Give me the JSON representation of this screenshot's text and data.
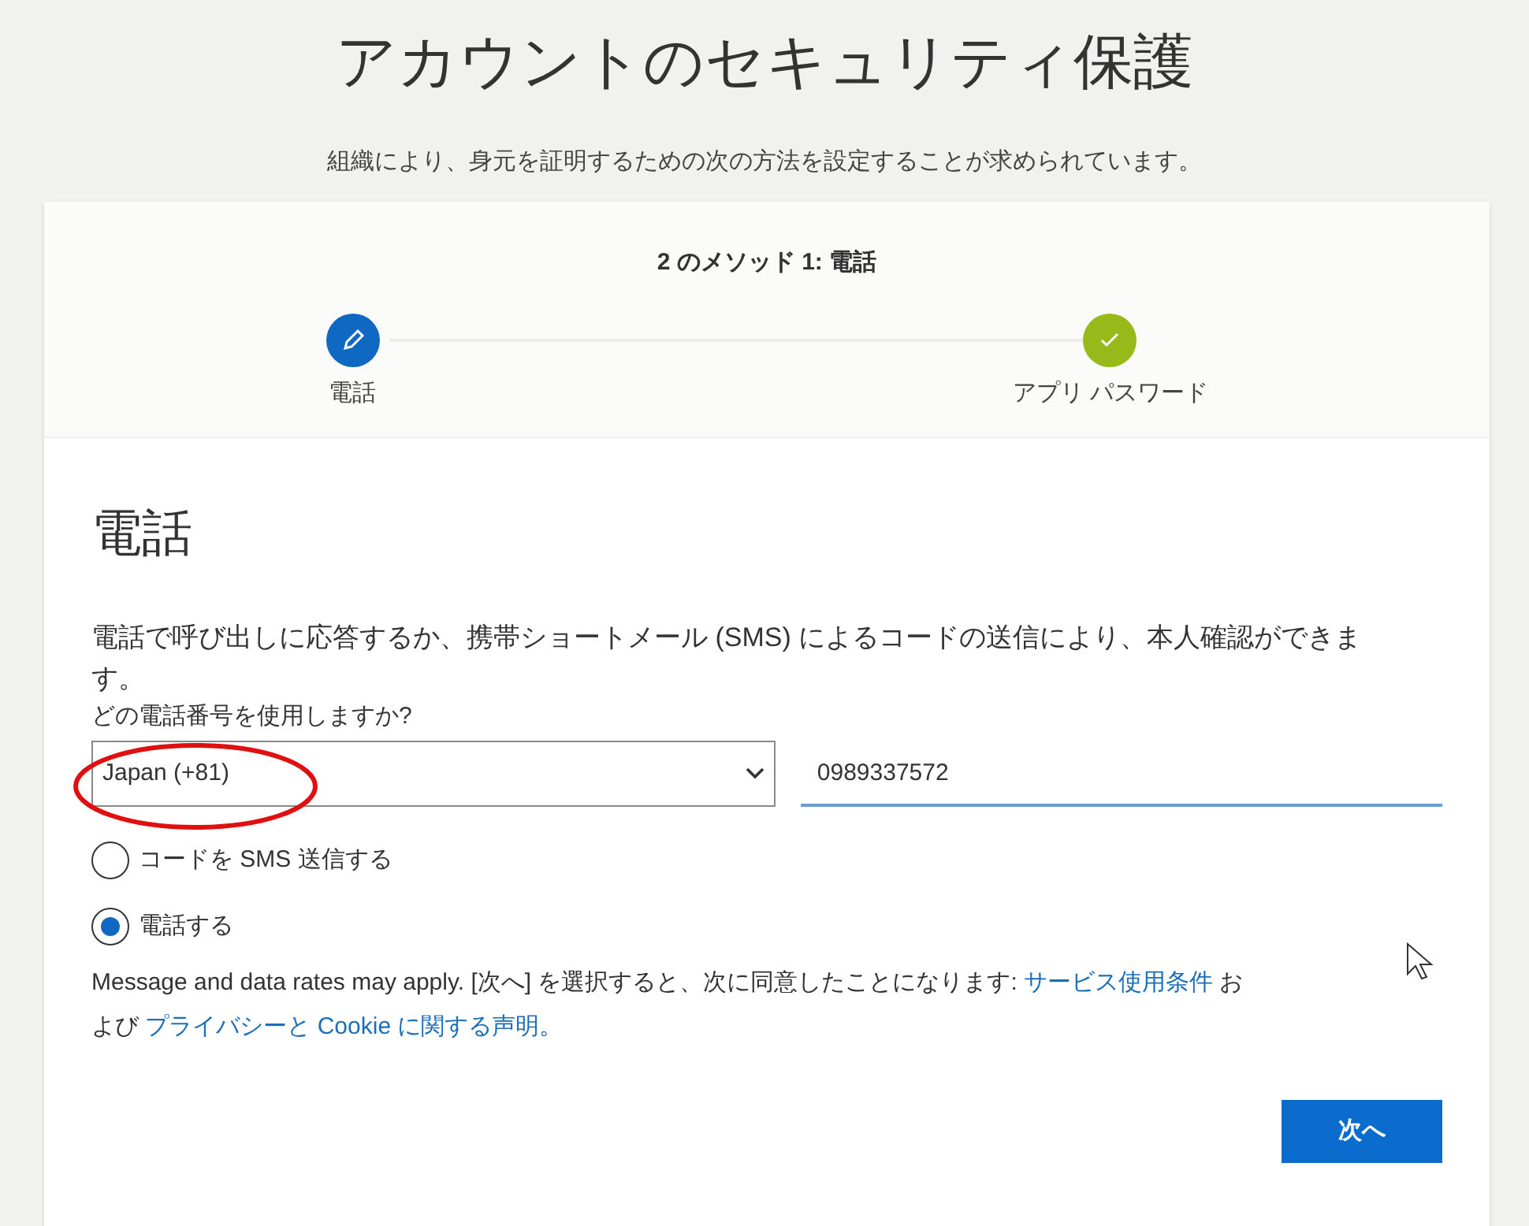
{
  "page": {
    "title": "アカウントのセキュリティ保護",
    "subtitle": "組織により、身元を証明するための次の方法を設定することが求められています。"
  },
  "progress": {
    "heading": "2 のメソッド 1: 電話",
    "steps": [
      {
        "label": "電話",
        "kind": "edit"
      },
      {
        "label": "アプリ パスワード",
        "kind": "check"
      }
    ]
  },
  "form": {
    "title": "電話",
    "description": "電話で呼び出しに応答するか、携帯ショートメール (SMS) によるコードの送信により、本人確認ができます。",
    "question": "どの電話番号を使用しますか?",
    "country": "Japan (+81)",
    "phone": "0989337572",
    "options": [
      {
        "label": "コードを SMS 送信する",
        "selected": false
      },
      {
        "label": "電話する",
        "selected": true
      }
    ],
    "terms": [
      {
        "kind": "text",
        "text": "Message and data rates may apply. [次へ] を選択すると、次に同意したことになります: "
      },
      {
        "kind": "link",
        "text": "サービス使用条件"
      },
      {
        "kind": "text",
        "text": " および "
      },
      {
        "kind": "link",
        "text": "プライバシーと Cookie に関する声明。"
      }
    ],
    "next_button": "次へ"
  }
}
